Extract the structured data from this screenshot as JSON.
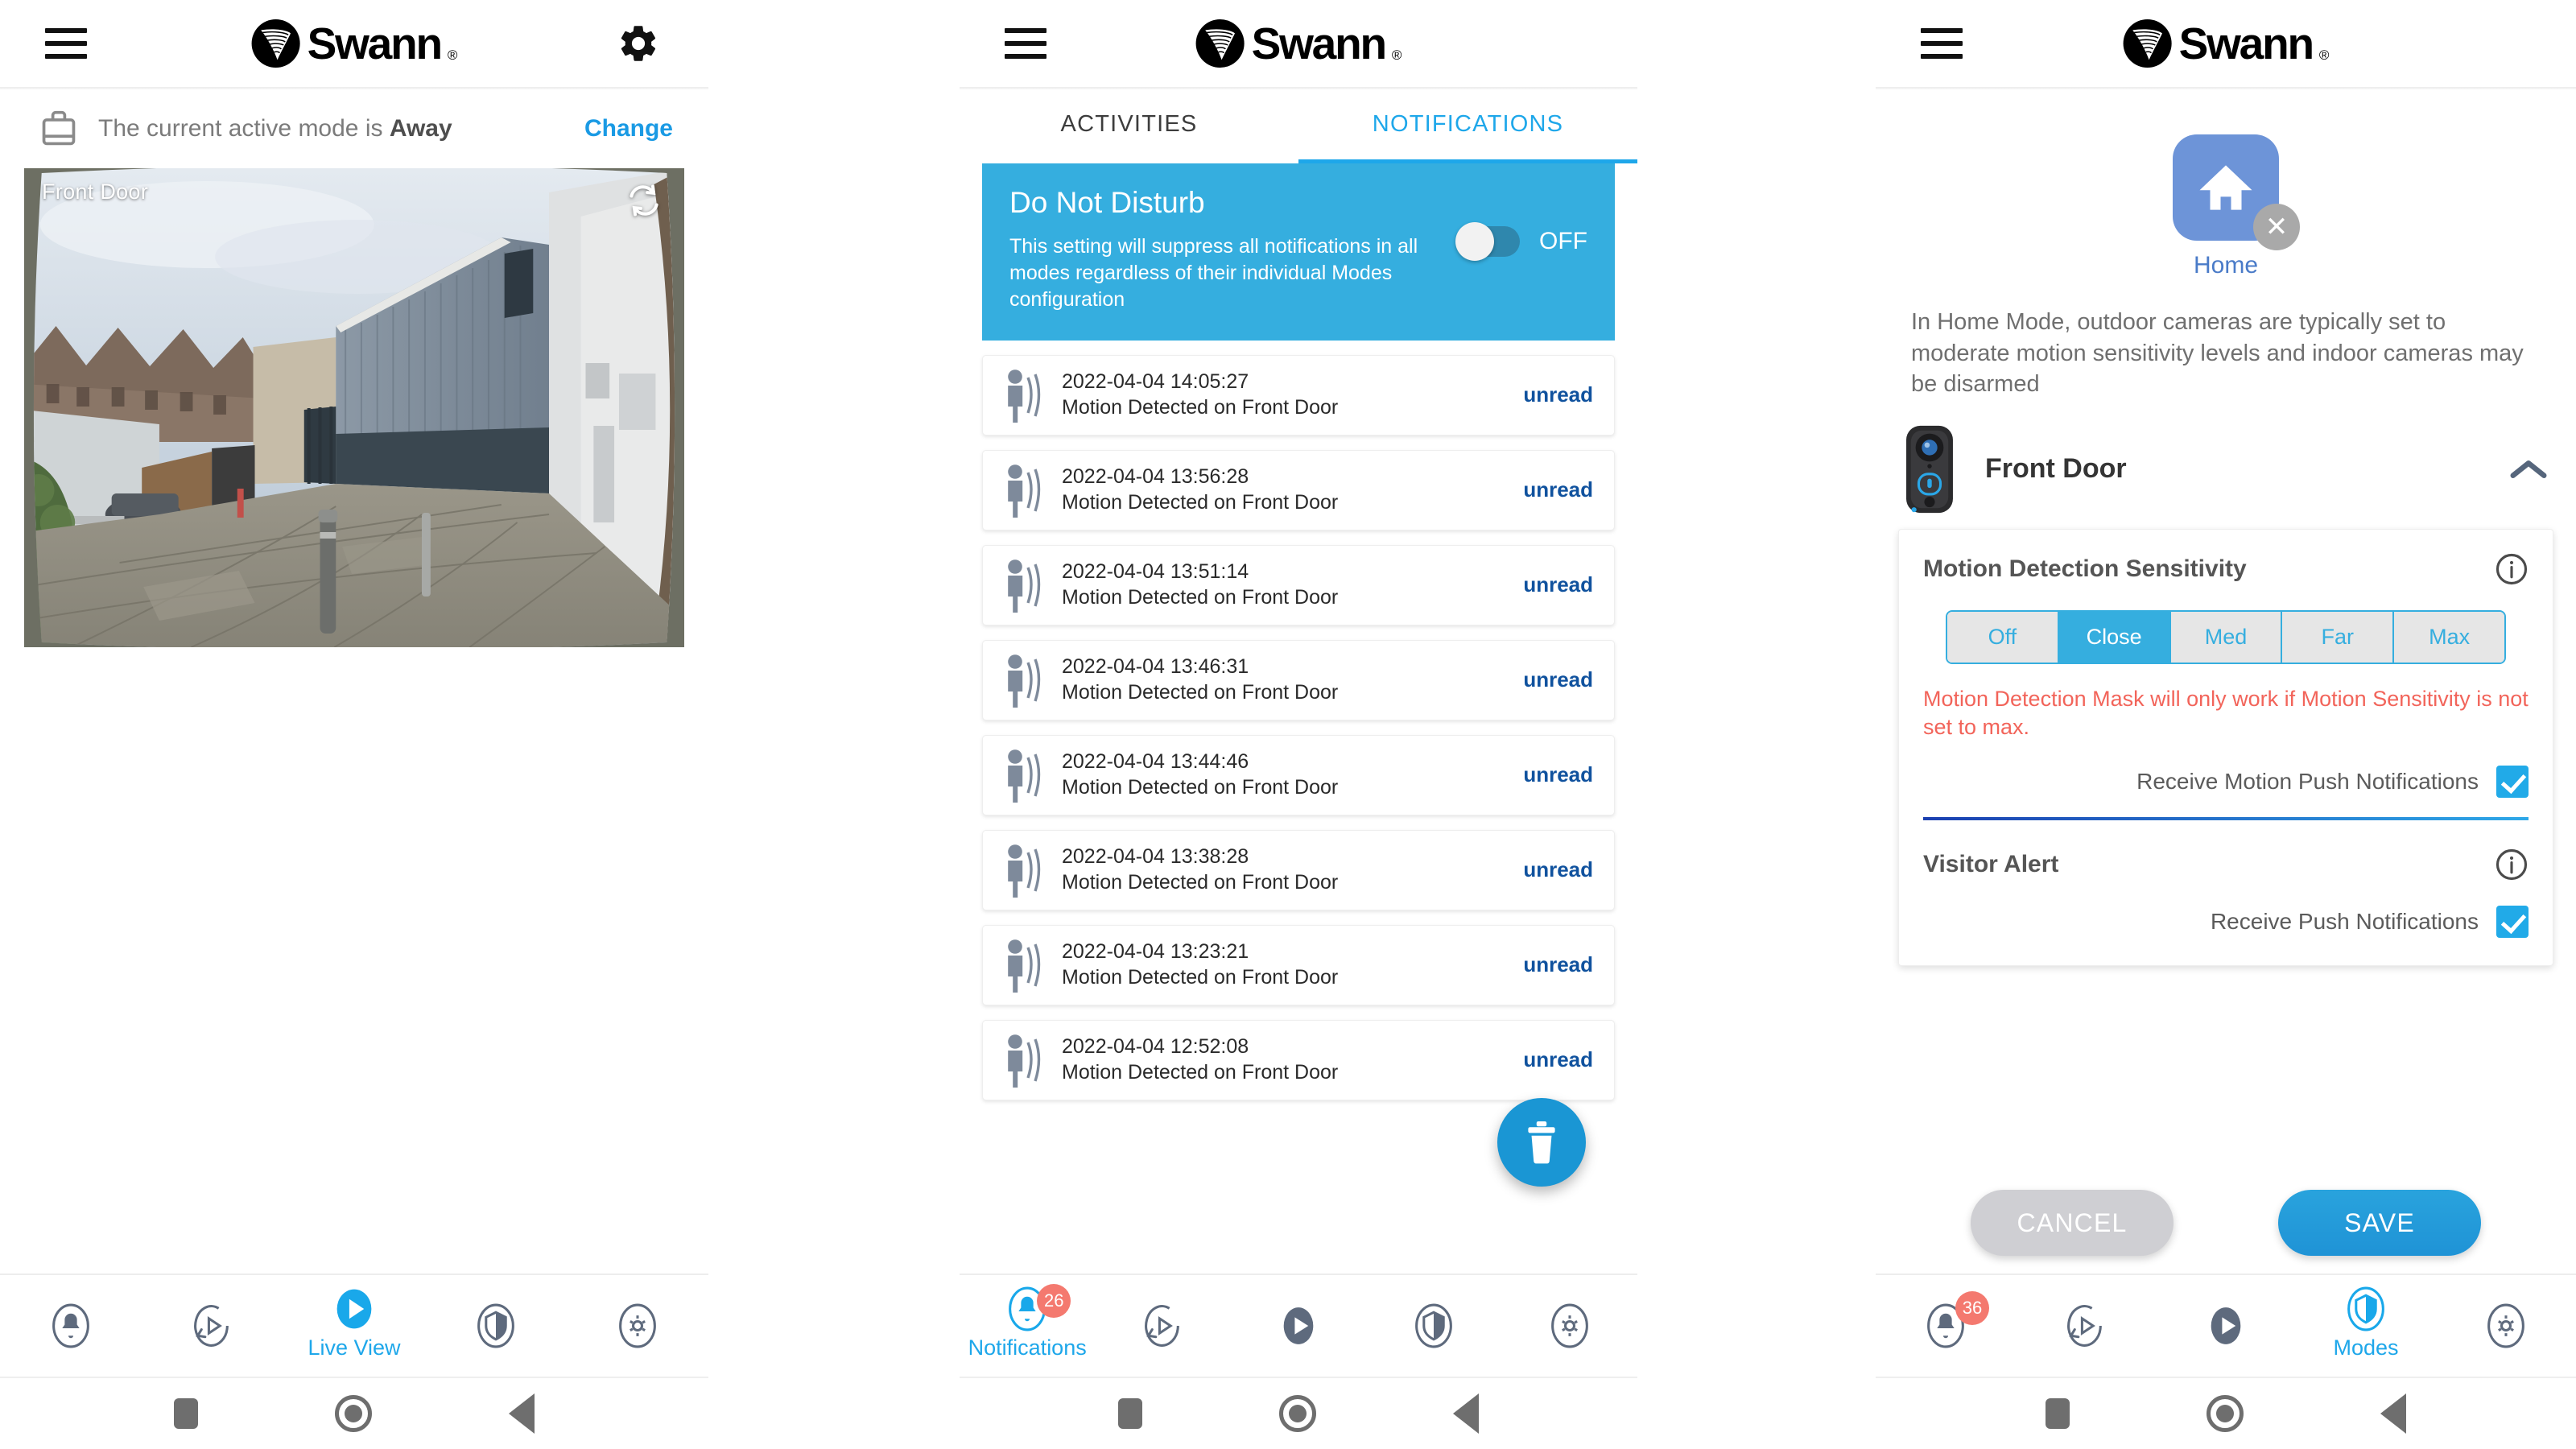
{
  "app": {
    "brand": "Swann",
    "brand_reg": "®"
  },
  "panel1": {
    "menu_icon": "hamburger-icon",
    "settings_icon": "gear-icon",
    "mode_bar": {
      "icon": "briefcase-icon",
      "text_prefix": "The current active mode is ",
      "mode": "Away",
      "change_label": "Change"
    },
    "camera": {
      "label": "Front Door",
      "refresh_icon": "refresh-icon"
    },
    "bottom_nav": [
      {
        "icon": "bell-icon",
        "label": "",
        "active": false
      },
      {
        "icon": "playback-icon",
        "label": "",
        "active": false
      },
      {
        "icon": "play-icon",
        "label": "Live View",
        "active": true
      },
      {
        "icon": "shield-icon",
        "label": "",
        "active": false
      },
      {
        "icon": "gear-icon",
        "label": "",
        "active": false
      }
    ]
  },
  "panel2": {
    "tabs": [
      {
        "label": "ACTIVITIES",
        "active": false
      },
      {
        "label": "NOTIFICATIONS",
        "active": true
      }
    ],
    "dnd": {
      "title": "Do Not Disturb",
      "description": "This setting will suppress all notifications in all modes regardless of their individual Modes configuration",
      "state_label": "OFF",
      "enabled": false,
      "bg_color": "#35aedf"
    },
    "notifications": [
      {
        "time": "2022-04-04 14:05:27",
        "message": "Motion Detected on Front Door",
        "status": "unread"
      },
      {
        "time": "2022-04-04 13:56:28",
        "message": "Motion Detected on Front Door",
        "status": "unread"
      },
      {
        "time": "2022-04-04 13:51:14",
        "message": "Motion Detected on Front Door",
        "status": "unread"
      },
      {
        "time": "2022-04-04 13:46:31",
        "message": "Motion Detected on Front Door",
        "status": "unread"
      },
      {
        "time": "2022-04-04 13:44:46",
        "message": "Motion Detected on Front Door",
        "status": "unread"
      },
      {
        "time": "2022-04-04 13:38:28",
        "message": "Motion Detected on Front Door",
        "status": "unread"
      },
      {
        "time": "2022-04-04 13:23:21",
        "message": "Motion Detected on Front Door",
        "status": "unread"
      },
      {
        "time": "2022-04-04 12:52:08",
        "message": "Motion Detected on Front Door",
        "status": "unread"
      }
    ],
    "delete_fab": {
      "icon": "trash-icon"
    },
    "bottom_nav": [
      {
        "icon": "bell-icon",
        "label": "Notifications",
        "badge": "26",
        "active": true
      },
      {
        "icon": "playback-icon",
        "label": "",
        "active": false
      },
      {
        "icon": "play-icon",
        "label": "",
        "active": false
      },
      {
        "icon": "shield-icon",
        "label": "",
        "active": false
      },
      {
        "icon": "gear-icon",
        "label": "",
        "active": false
      }
    ]
  },
  "panel3": {
    "mode": {
      "icon": "home-icon",
      "name": "Home",
      "remove_icon": "x-icon",
      "description": "In Home Mode, outdoor cameras are typically set to moderate motion sensitivity levels and indoor cameras may be disarmed",
      "tile_color": "#6d94d8"
    },
    "device": {
      "name": "Front Door",
      "thumb_icon": "doorbell-camera-icon",
      "collapse_icon": "chevron-up-icon"
    },
    "motion": {
      "title": "Motion Detection Sensitivity",
      "info_icon": "info-icon",
      "options": [
        "Off",
        "Close",
        "Med",
        "Far",
        "Max"
      ],
      "selected": "Close",
      "warning": "Motion Detection Mask will only work if Motion Sensitivity is not set to max.",
      "push_label": "Receive Motion Push Notifications",
      "push_checked": true
    },
    "visitor": {
      "title": "Visitor Alert",
      "info_icon": "info-icon",
      "push_label": "Receive Push Notifications",
      "push_checked": true
    },
    "actions": {
      "cancel_label": "CANCEL",
      "save_label": "SAVE"
    },
    "bottom_nav": [
      {
        "icon": "bell-icon",
        "label": "",
        "badge": "36",
        "active": false
      },
      {
        "icon": "playback-icon",
        "label": "",
        "active": false
      },
      {
        "icon": "play-icon",
        "label": "",
        "active": false
      },
      {
        "icon": "shield-icon",
        "label": "Modes",
        "active": true
      },
      {
        "icon": "gear-icon",
        "label": "",
        "active": false
      }
    ]
  },
  "colors": {
    "accent_blue": "#1ea7ea",
    "dnd_blue": "#35aedf",
    "unread_blue": "#10529e",
    "warn_red": "#f2645a",
    "badge_red": "#f4796f",
    "nav_gray": "#5e6a7d"
  }
}
